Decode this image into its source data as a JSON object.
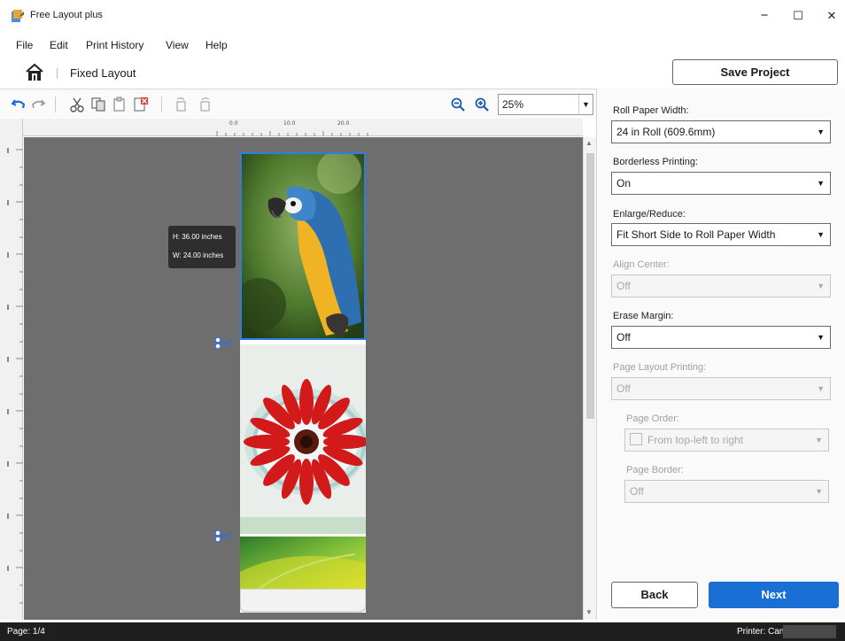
{
  "window": {
    "title": "Free Layout plus",
    "minimize": "−",
    "maximize": "☐",
    "close": "✕"
  },
  "menu": [
    "File",
    "Edit",
    "Print History",
    "View",
    "Help"
  ],
  "breadcrumb": {
    "label": "Fixed Layout"
  },
  "toolbar": {
    "save_project": "Save Project",
    "zoom_value": "25%"
  },
  "ruler": {
    "labels": [
      "0.0",
      "10.0",
      "20.0"
    ]
  },
  "canvas": {
    "tooltip_height": "H: 36.00 inches",
    "tooltip_width": "W: 24.00 inches"
  },
  "panel": {
    "roll_paper_width": {
      "label": "Roll Paper Width:",
      "value": "24 in Roll (609.6mm)"
    },
    "borderless_printing": {
      "label": "Borderless Printing:",
      "value": "On"
    },
    "enlarge_reduce": {
      "label": "Enlarge/Reduce:",
      "value": "Fit Short Side to Roll Paper Width"
    },
    "align_center": {
      "label": "Align Center:",
      "value": "Off"
    },
    "erase_margin": {
      "label": "Erase Margin:",
      "value": "Off"
    },
    "page_layout_printing": {
      "label": "Page Layout Printing:",
      "value": "Off"
    },
    "page_order": {
      "label": "Page Order:",
      "value": "From top-left to right"
    },
    "page_border": {
      "label": "Page Border:",
      "value": "Off"
    },
    "back": "Back",
    "next": "Next"
  },
  "status": {
    "page": "Page: 1/4",
    "printer": "Printer: Canon"
  },
  "colors": {
    "accent": "#1a6fd4",
    "selection": "#2f7de1",
    "canvas": "#6e6e6e"
  }
}
